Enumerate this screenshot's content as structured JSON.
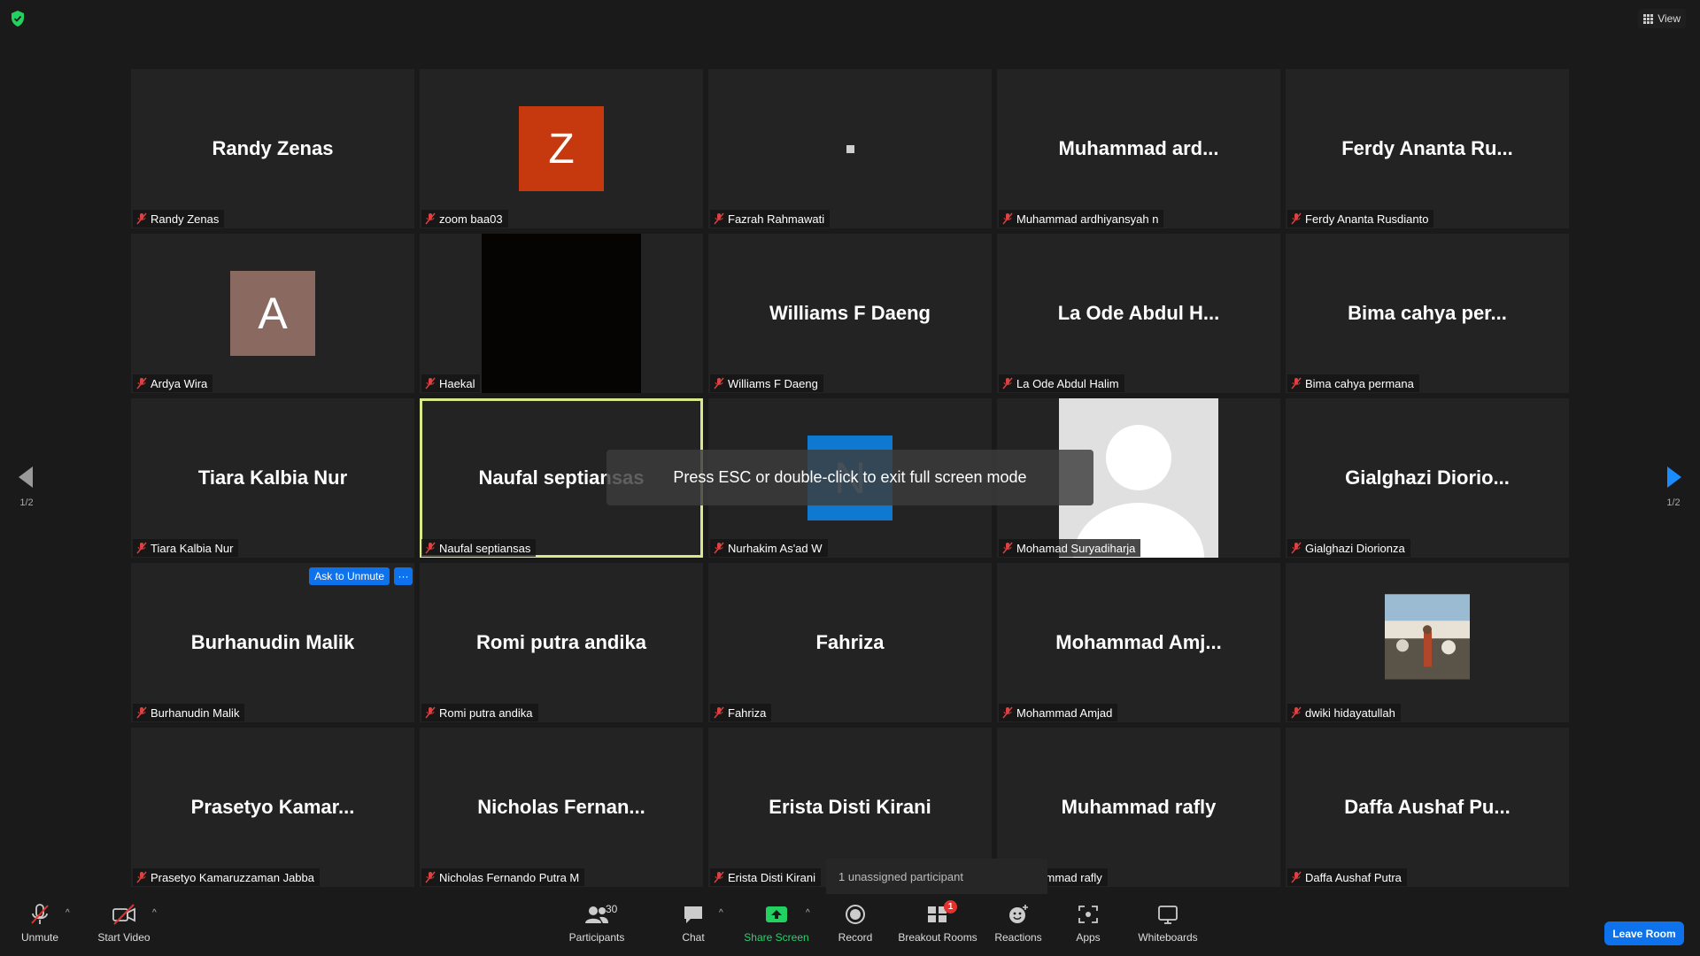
{
  "view_label": "View",
  "fullscreen_hint": "Press ESC or double-click to exit full screen mode",
  "pager": {
    "left": "1/2",
    "right": "1/2"
  },
  "tooltip": "1 unassigned participant",
  "tiles": [
    {
      "big": "Randy Zenas",
      "label": "Randy Zenas"
    },
    {
      "avatar": "Z",
      "label": "zoom baa03"
    },
    {
      "label": "Fazrah Rahmawati"
    },
    {
      "big": "Muhammad  ard...",
      "label": "Muhammad ardhiyansyah n"
    },
    {
      "big": "Ferdy  Ananta  Ru...",
      "label": "Ferdy Ananta Rusdianto"
    },
    {
      "avatar": "A",
      "label": "Ardya Wira"
    },
    {
      "label": "Haekal"
    },
    {
      "big": "Williams F Daeng",
      "label": "Williams F Daeng"
    },
    {
      "big": "La Ode Abdul H...",
      "label": "La Ode Abdul Halim"
    },
    {
      "big": "Bima cahya per...",
      "label": "Bima cahya permana"
    },
    {
      "big": "Tiara Kalbia Nur",
      "label": "Tiara Kalbia Nur"
    },
    {
      "big": "Naufal septiansas",
      "label": "Naufal septiansas"
    },
    {
      "avatar": "N",
      "label": "Nurhakim As'ad W"
    },
    {
      "label": "Mohamad Suryadiharja"
    },
    {
      "big": "Gialghazi  Diorio...",
      "label": "Gialghazi Diorionza"
    },
    {
      "big": "Burhanudin Malik",
      "label": "Burhanudin Malik",
      "ask_unmute": "Ask to Unmute",
      "more": "···"
    },
    {
      "big": "Romi putra andika",
      "label": "Romi putra andika"
    },
    {
      "big": "Fahriza",
      "label": "Fahriza"
    },
    {
      "big": "Mohammad  Amj...",
      "label": "Mohammad Amjad"
    },
    {
      "label": "dwiki hidayatullah"
    },
    {
      "big": "Prasetyo  Kamar...",
      "label": "Prasetyo Kamaruzzaman Jabba"
    },
    {
      "big": "Nicholas  Fernan...",
      "label": "Nicholas Fernando Putra M"
    },
    {
      "big": "Erista Disti Kirani",
      "label": "Erista Disti Kirani"
    },
    {
      "big": "Muhammad rafly",
      "label": "Muhammad rafly"
    },
    {
      "big": "Daffa  Aushaf  Pu...",
      "label": "Daffa Aushaf Putra"
    }
  ],
  "toolbar": {
    "unmute": "Unmute",
    "start_video": "Start Video",
    "participants": "Participants",
    "participants_count": "30",
    "chat": "Chat",
    "share_screen": "Share Screen",
    "record": "Record",
    "breakout_rooms": "Breakout Rooms",
    "breakout_badge": "1",
    "reactions": "Reactions",
    "apps": "Apps",
    "whiteboards": "Whiteboards",
    "leave": "Leave Room"
  }
}
